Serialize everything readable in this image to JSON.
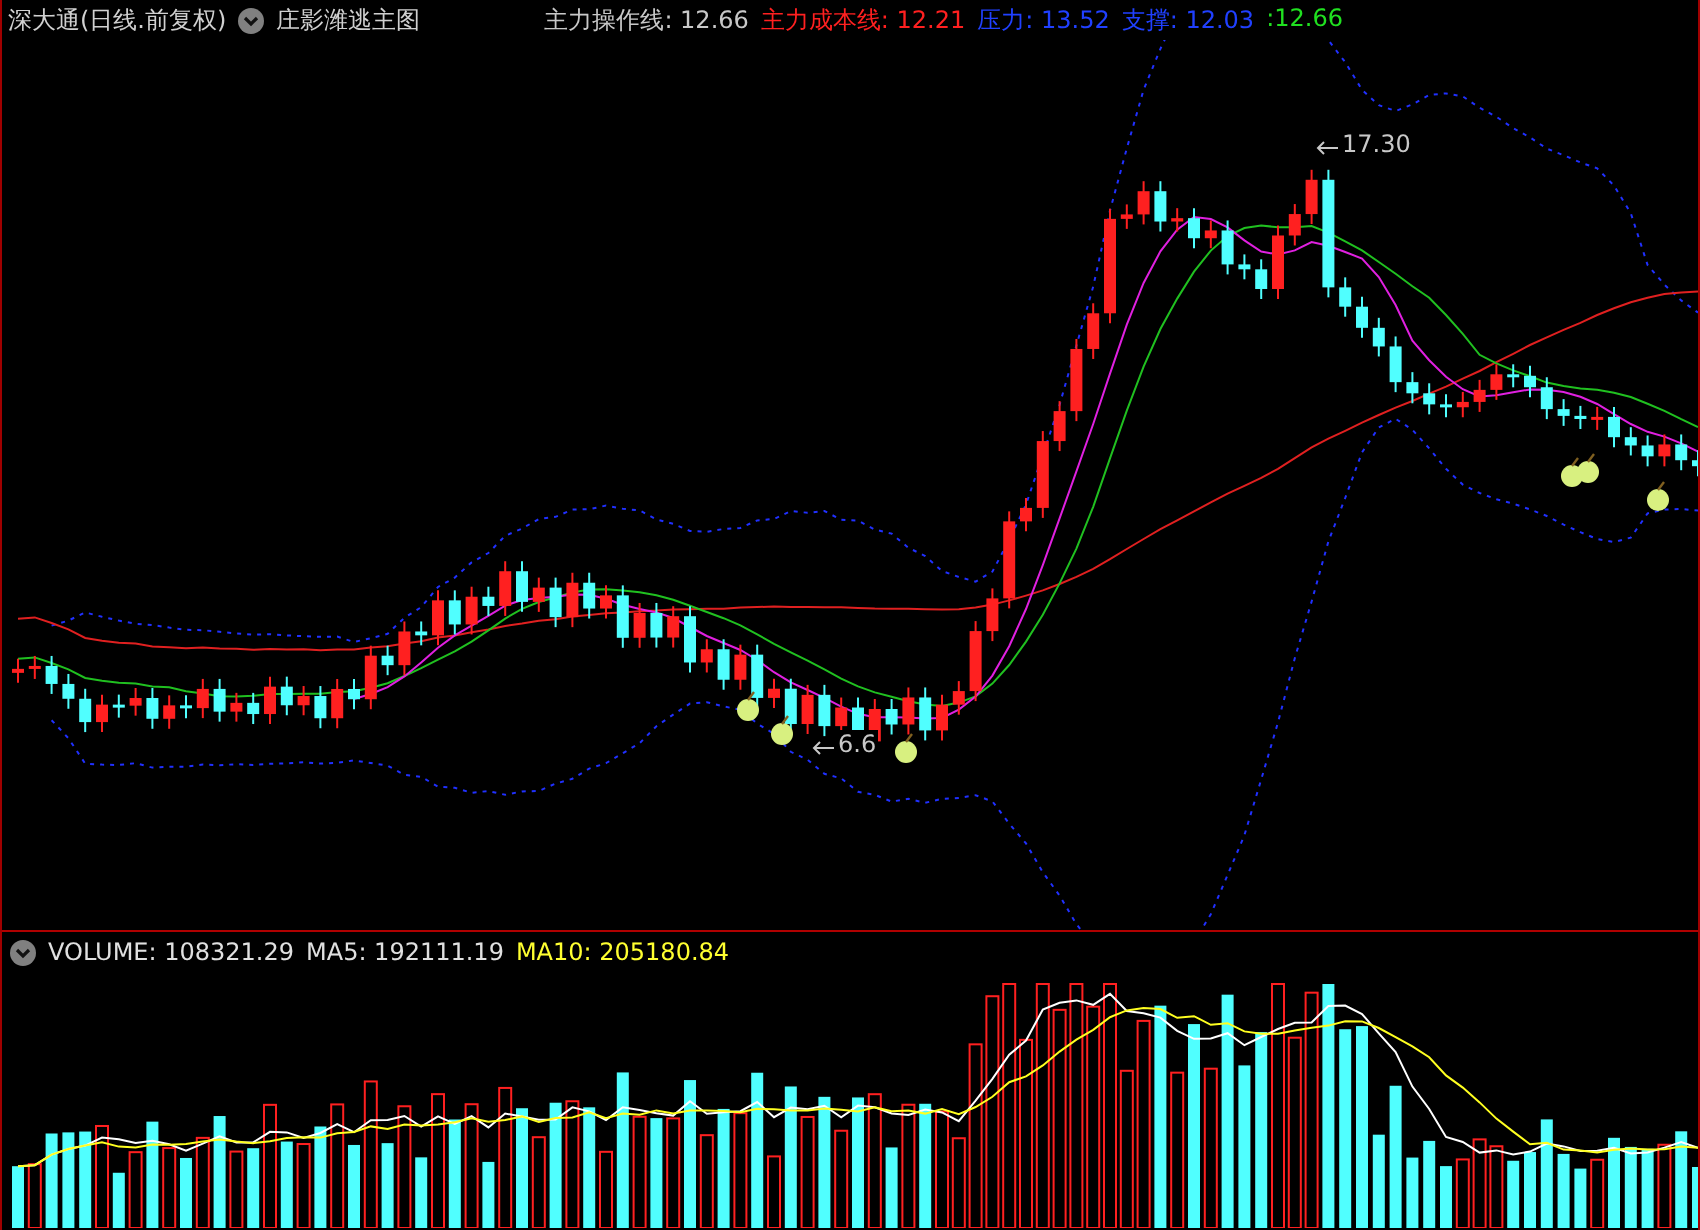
{
  "main_panel": {
    "title": "深大通(日线.前复权)",
    "indicator": "庄影潍逃主图",
    "legend": [
      {
        "text": "主力操作线: 12.66",
        "color": "#c8c8c8"
      },
      {
        "text": "主力成本线: 12.21",
        "color": "#ff2020"
      },
      {
        "text": "压力: 13.52",
        "color": "#2040ff"
      },
      {
        "text": "支撑: 12.03",
        "color": "#2040ff"
      },
      {
        "text": ":12.66",
        "color": "#20e020"
      }
    ],
    "annotations": [
      {
        "kind": "high",
        "text": "17.30"
      },
      {
        "kind": "low",
        "text": "6.6"
      }
    ]
  },
  "volume_panel": {
    "legend": [
      {
        "text": "VOLUME: 108321.29",
        "color": "#e0e0e0"
      },
      {
        "text": "MA5: 192111.19",
        "color": "#e0e0e0"
      },
      {
        "text": "MA10: 205180.84",
        "color": "#ffff30"
      }
    ]
  }
}
